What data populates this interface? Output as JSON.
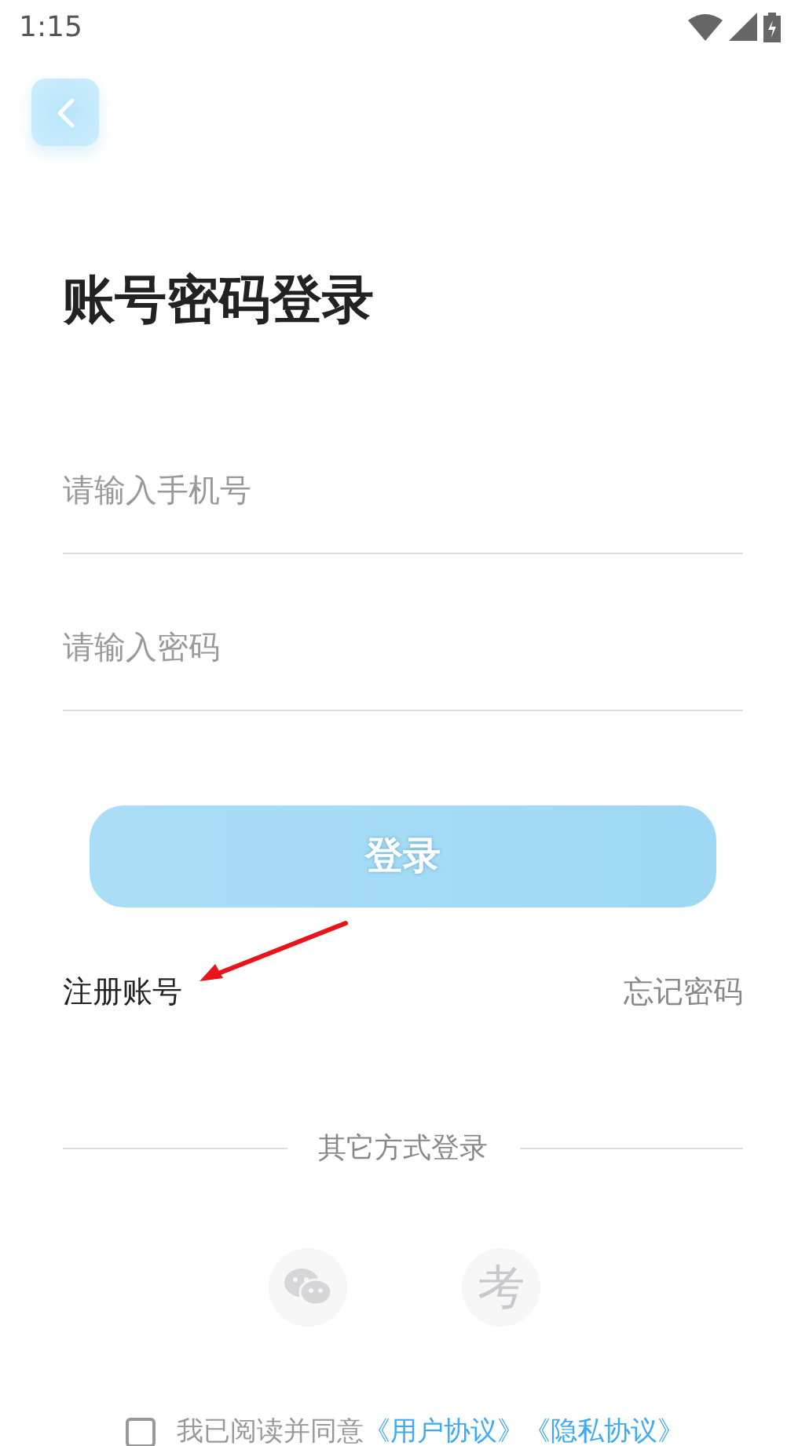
{
  "status_bar": {
    "time": "1:15"
  },
  "title": "账号密码登录",
  "fields": [
    {
      "placeholder": "请输入手机号"
    },
    {
      "placeholder": "请输入密码"
    }
  ],
  "login_button": {
    "label": "登录",
    "disabled": true
  },
  "register_link": "注册账号",
  "forgot_link": "忘记密码",
  "other_login": {
    "label": "其它方式登录",
    "options": [
      {
        "kind": "wechat"
      },
      {
        "kind": "text",
        "glyph": "考"
      }
    ]
  },
  "agreement": {
    "checked": false,
    "text": "我已阅读并同意",
    "links": [
      "《用户协议》",
      "《隐私协议》"
    ]
  }
}
